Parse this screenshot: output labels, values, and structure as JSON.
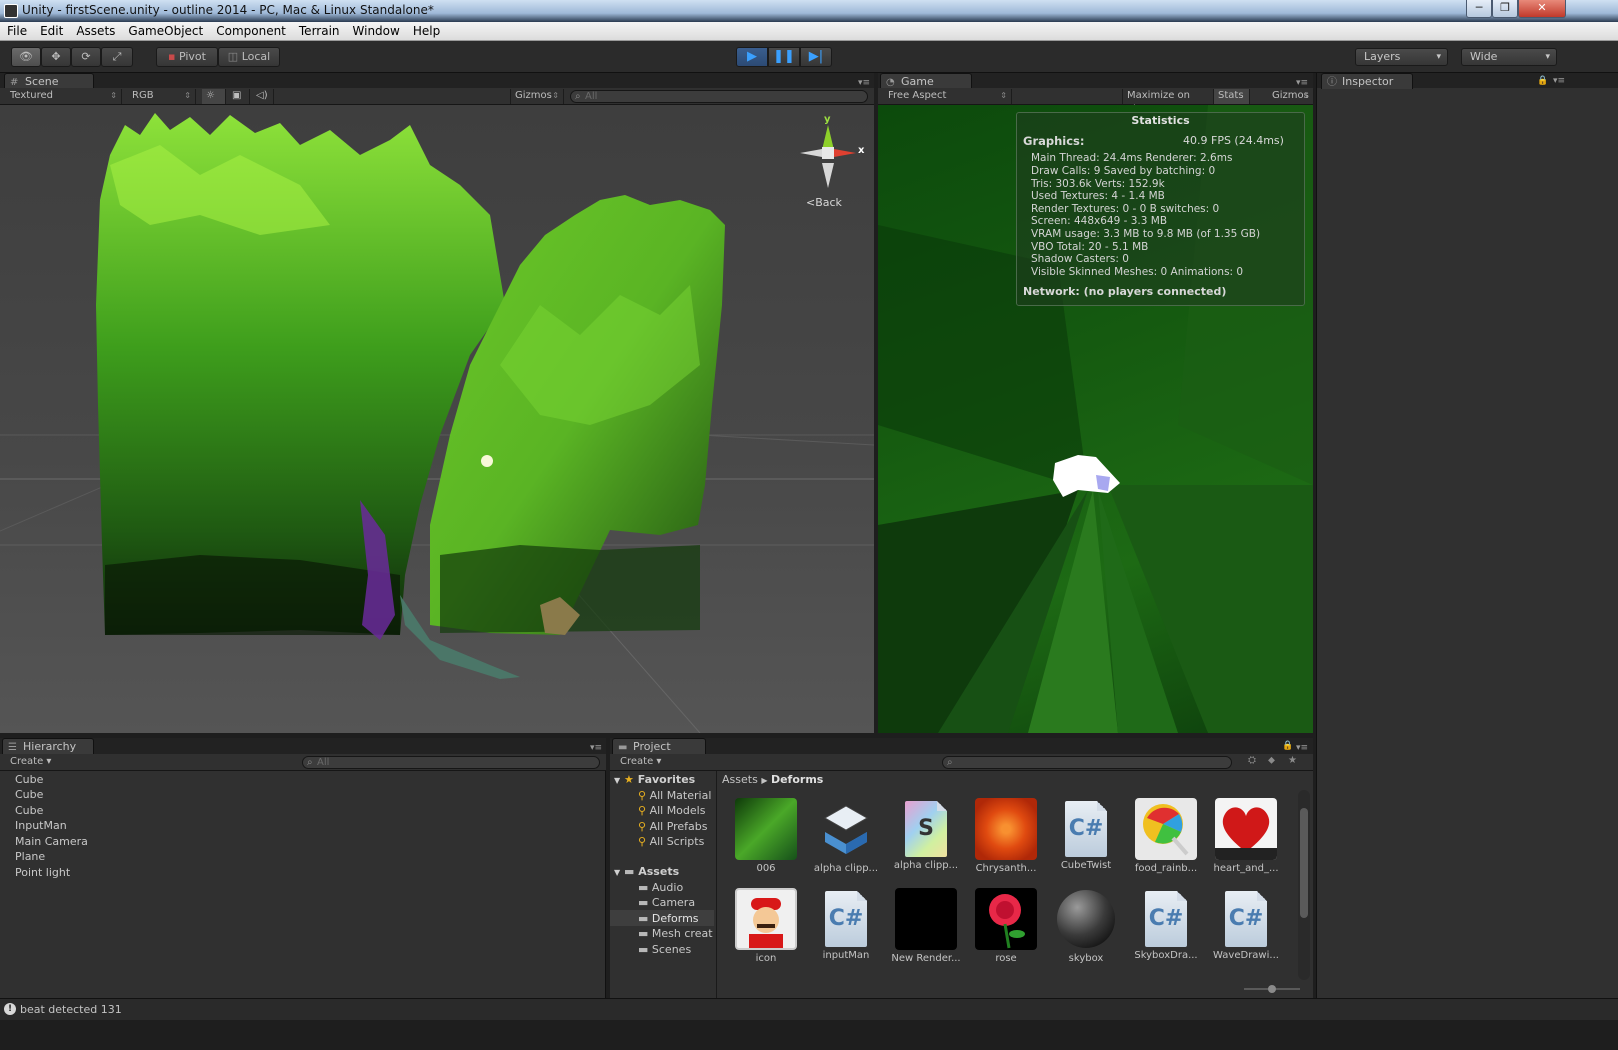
{
  "window": {
    "title": "Unity - firstScene.unity - outline 2014 - PC, Mac & Linux Standalone*"
  },
  "menu": [
    "File",
    "Edit",
    "Assets",
    "GameObject",
    "Component",
    "Terrain",
    "Window",
    "Help"
  ],
  "toolbar": {
    "pivot_label": "Pivot",
    "local_label": "Local",
    "layers_label": "Layers",
    "layout_label": "Wide"
  },
  "scene": {
    "tab_label": "Scene",
    "draw_mode": "Textured",
    "render_mode": "RGB",
    "gizmos_label": "Gizmos",
    "search_placeholder": "All",
    "gizmo_y": "y",
    "gizmo_x": "x",
    "view_label": "Back"
  },
  "game": {
    "tab_label": "Game",
    "aspect": "Free Aspect",
    "maximize_label": "Maximize on Play",
    "stats_label": "Stats",
    "gizmos_label": "Gizmos"
  },
  "stats": {
    "header": "Statistics",
    "graphics_label": "Graphics:",
    "fps": "40.9 FPS (24.4ms)",
    "lines": [
      "Main Thread: 24.4ms   Renderer: 2.6ms",
      "Draw Calls: 9   Saved by batching: 0",
      "Tris: 303.6k      Verts: 152.9k",
      "Used Textures: 4 - 1.4 MB",
      "Render Textures: 0 - 0 B   switches: 0",
      "Screen: 448x649 - 3.3 MB",
      "VRAM usage: 3.3 MB to 9.8 MB (of 1.35 GB)",
      "VBO Total: 20 - 5.1 MB",
      "Shadow Casters: 0",
      "Visible Skinned Meshes: 0      Animations: 0"
    ],
    "network": "Network: (no players connected)"
  },
  "inspector": {
    "tab_label": "Inspector"
  },
  "hierarchy": {
    "tab_label": "Hierarchy",
    "create_label": "Create",
    "search_placeholder": "All",
    "items": [
      "Cube",
      "Cube",
      "Cube",
      "InputMan",
      "Main Camera",
      "Plane",
      "Point light"
    ]
  },
  "project": {
    "tab_label": "Project",
    "create_label": "Create",
    "favorites_label": "Favorites",
    "favorites": [
      "All Material",
      "All Models",
      "All Prefabs",
      "All Scripts"
    ],
    "assets_label": "Assets",
    "folders": [
      "Audio",
      "Camera",
      "Deforms",
      "Mesh creat",
      "Scenes"
    ],
    "selected_folder": "Deforms",
    "breadcrumb": [
      "Assets",
      "Deforms"
    ],
    "assets": [
      {
        "label": "006",
        "type": "texture-leaf"
      },
      {
        "label": "alpha clipp...",
        "type": "prefab"
      },
      {
        "label": "alpha clipp...",
        "type": "shader"
      },
      {
        "label": "Chrysanth...",
        "type": "texture-flower"
      },
      {
        "label": "CubeTwist",
        "type": "script"
      },
      {
        "label": "food_rainb...",
        "type": "texture-lollipop"
      },
      {
        "label": "heart_and_...",
        "type": "texture-heart"
      },
      {
        "label": "icon",
        "type": "texture-mario"
      },
      {
        "label": "inputMan",
        "type": "script"
      },
      {
        "label": "New Render...",
        "type": "render-texture"
      },
      {
        "label": "rose",
        "type": "texture-rose"
      },
      {
        "label": "skybox",
        "type": "material-sphere"
      },
      {
        "label": "SkyboxDra...",
        "type": "script"
      },
      {
        "label": "WaveDrawi...",
        "type": "script"
      }
    ]
  },
  "status": {
    "message": "beat detected 131"
  }
}
